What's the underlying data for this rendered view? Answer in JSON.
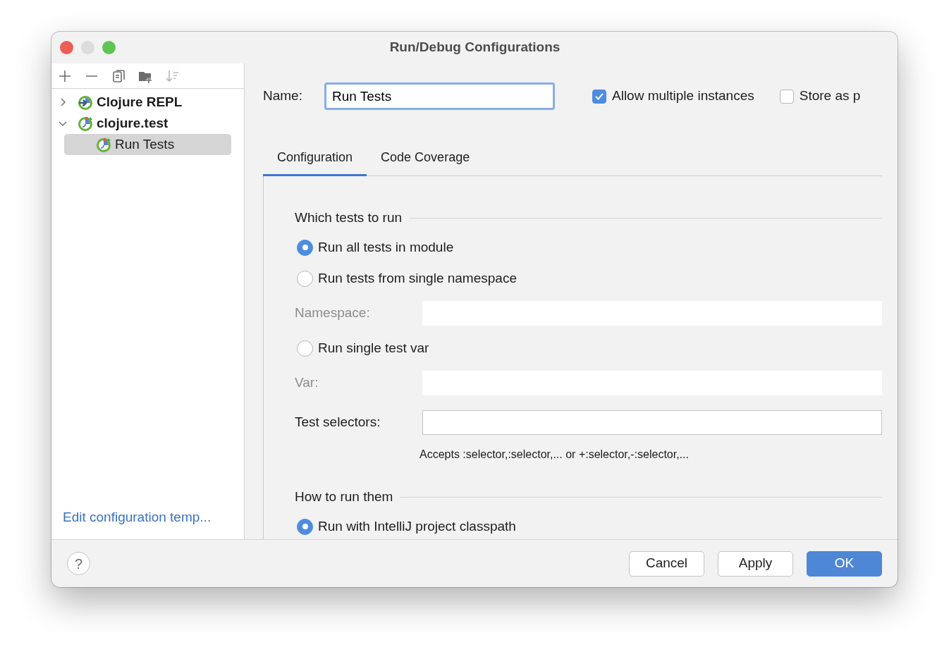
{
  "window": {
    "title": "Run/Debug Configurations"
  },
  "toolbar": [
    {
      "kind": "add",
      "disabled": false
    },
    {
      "kind": "remove",
      "disabled": false
    },
    {
      "kind": "copy",
      "disabled": false
    },
    {
      "kind": "folder",
      "disabled": false
    },
    {
      "kind": "sort",
      "disabled": true
    }
  ],
  "tree": [
    {
      "label": "Clojure REPL",
      "kind": "repl",
      "expanded": false,
      "selected": false
    },
    {
      "label": "clojure.test",
      "kind": "test",
      "expanded": true,
      "selected": false,
      "children": [
        {
          "label": "Run Tests",
          "kind": "test",
          "selected": true
        }
      ]
    }
  ],
  "sidebar_link": "Edit configuration temp...",
  "name_field": {
    "label": "Name:",
    "value": "Run Tests"
  },
  "options": [
    {
      "label": "Allow multiple instances",
      "checked": true
    },
    {
      "label": "Store as p",
      "checked": false
    }
  ],
  "tabs": [
    {
      "label": "Configuration",
      "selected": true
    },
    {
      "label": "Code Coverage",
      "selected": false
    }
  ],
  "sections": [
    {
      "title": "Which tests to run",
      "rows": [
        {
          "kind": "radio",
          "label": "Run all tests in module",
          "selected": true
        },
        {
          "kind": "radio",
          "label": "Run tests from single namespace",
          "selected": false
        },
        {
          "kind": "field",
          "label": "Namespace:",
          "disabled": true
        },
        {
          "kind": "radio",
          "label": "Run single test var",
          "selected": false
        },
        {
          "kind": "field",
          "label": "Var:",
          "disabled": true
        },
        {
          "kind": "field",
          "label": "Test selectors:",
          "disabled": false
        },
        {
          "kind": "hint",
          "text": "Accepts :selector,:selector,... or +:selector,-:selector,..."
        }
      ]
    },
    {
      "title": "How to run them",
      "rows": [
        {
          "kind": "radio",
          "label": "Run with IntelliJ project classpath",
          "selected": true
        }
      ]
    }
  ],
  "footer": {
    "help": "?",
    "buttons": [
      {
        "label": "Cancel",
        "kind": "secondary"
      },
      {
        "label": "Apply",
        "kind": "secondary"
      },
      {
        "label": "OK",
        "kind": "default"
      }
    ]
  }
}
